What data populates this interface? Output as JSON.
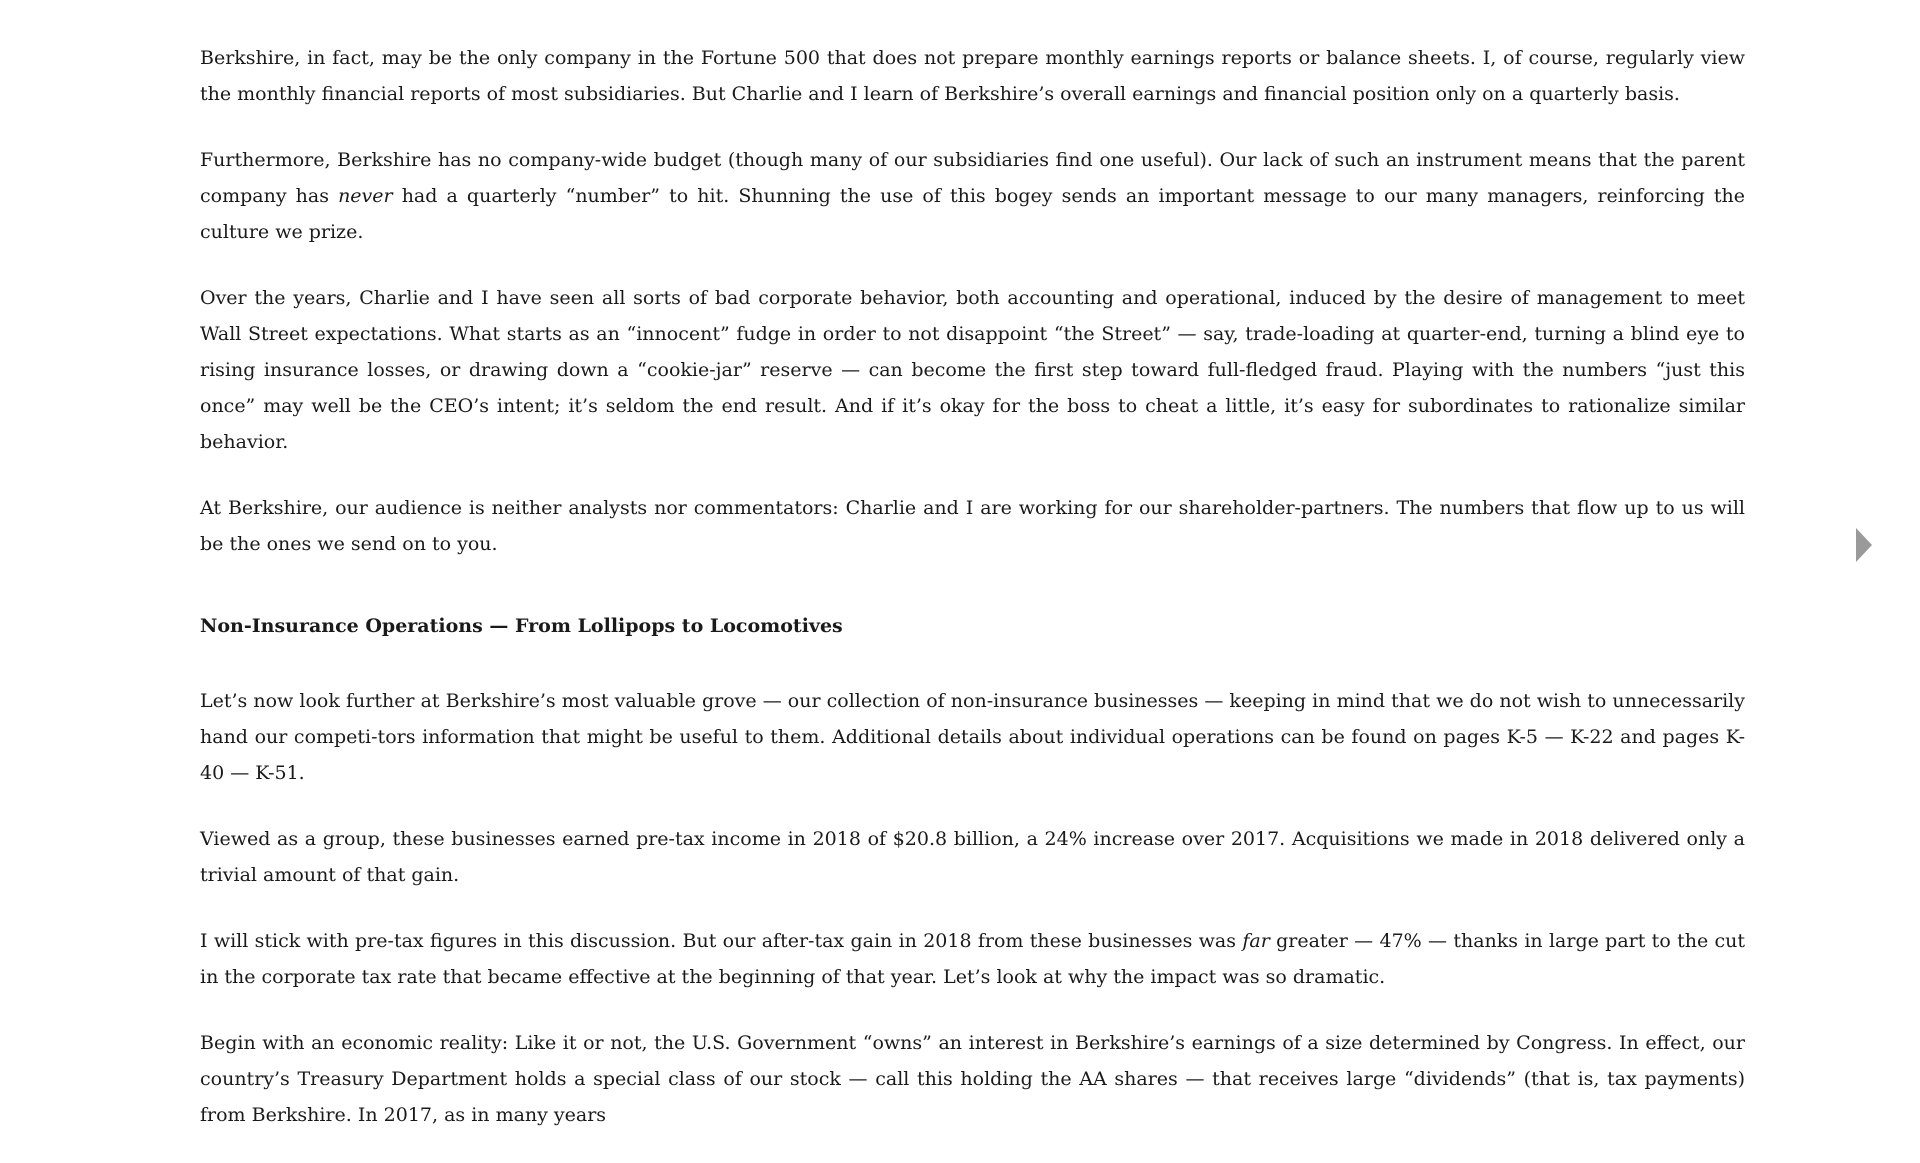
{
  "paragraphs": [
    "Berkshire, in fact, may be the only company in the Fortune 500 that does not prepare monthly earnings reports or balance sheets. I, of course, regularly view the monthly financial reports of most subsidiaries. But Charlie and I learn of Berkshire’s overall earnings and financial position only on a quarterly basis.",
    {
      "before": "Furthermore, Berkshire has no company-wide budget (though many of our subsidiaries find one useful). Our lack of such an instrument means that the parent company has ",
      "em": "never",
      "after": " had a quarterly “number” to hit. Shunning the use of this bogey sends an important message to our many managers, reinforcing the culture we prize."
    },
    "Over the years, Charlie and I have seen all sorts of bad corporate behavior, both accounting and operational, induced by the desire of management to meet Wall Street expectations. What starts as an “innocent” fudge in order to not disappoint “the Street” — say, trade-loading at quarter-end, turning a blind eye to rising insurance losses, or drawing down a “cookie-jar” reserve — can become the first step toward full-fledged fraud. Playing with the numbers “just this once” may well be the CEO’s intent; it’s seldom the end result. And if it’s okay for the boss to cheat a little, it’s easy for subordinates to rationalize similar behavior.",
    "At Berkshire, our audience is neither analysts nor commentators: Charlie and I are working for our shareholder-partners. The numbers that flow up to us will be the ones we send on to you."
  ],
  "section_heading": "Non-Insurance Operations — From Lollipops to Locomotives",
  "section_paragraphs": [
    "Let’s now look further at Berkshire’s most valuable grove — our collection of non-insurance businesses — keeping in mind that we do not wish to unnecessarily hand our competi-tors information that might be useful to them. Additional details about individual operations can be found on pages K-5 — K-22 and pages K-40 — K-51.",
    "Viewed as a group, these businesses earned pre-tax income in 2018 of $20.8 billion, a 24% increase over 2017. Acquisitions we made in 2018 delivered only a trivial amount of that gain.",
    {
      "before": "I will stick with pre-tax figures in this discussion. But our after-tax gain in 2018 from these businesses was ",
      "em": "far",
      "after": " greater — 47% — thanks in large part to the cut in the corporate tax rate that became effective at the beginning of that year. Let’s look at why the impact was so dramatic."
    },
    "Begin with an economic reality: Like it or not, the U.S. Government “owns” an interest in Berkshire’s earnings of a size determined by Congress. In effect, our country’s Treasury Department holds a special class of our stock — call this holding the AA shares — that receives large “dividends” (that is, tax payments) from Berkshire. In 2017, as in many years"
  ],
  "nav": {
    "next_icon": "triangle-right-icon",
    "arrow_color": "#9a9a9a"
  }
}
